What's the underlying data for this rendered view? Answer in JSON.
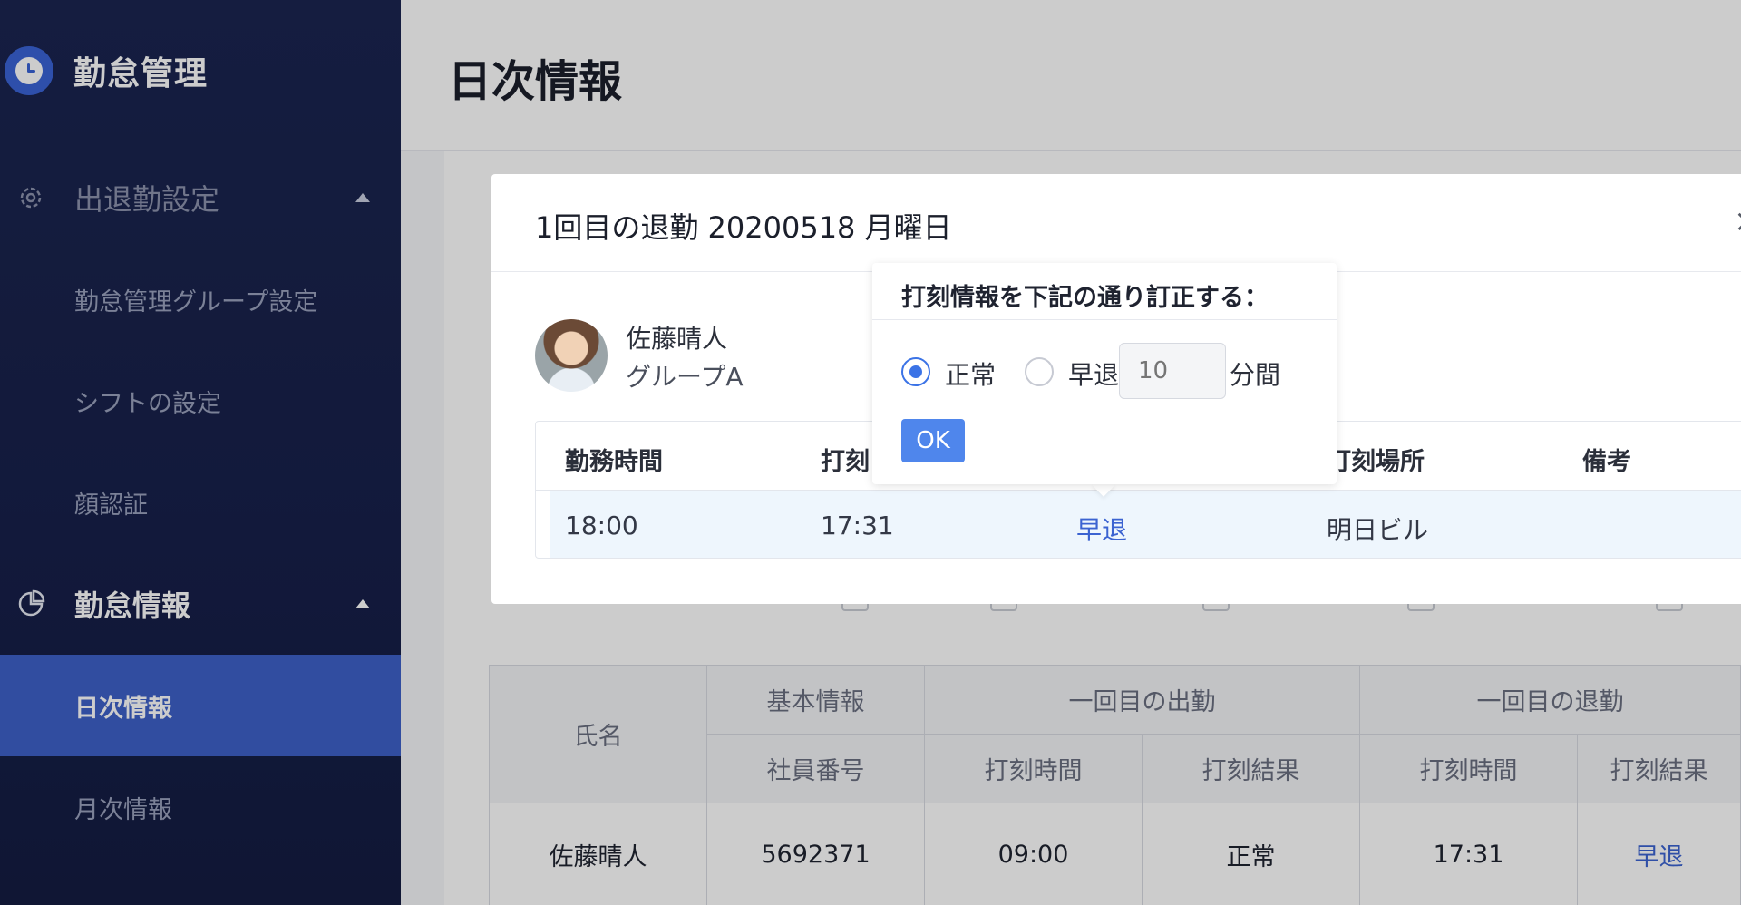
{
  "sidebar": {
    "brand": "勤怠管理",
    "groups": [
      {
        "label": "出退勤設定"
      },
      {
        "label": "勤怠情報"
      }
    ],
    "items": [
      {
        "label": "勤怠管理グループ設定"
      },
      {
        "label": "シフトの設定"
      },
      {
        "label": "顔認証"
      },
      {
        "label": "日次情報"
      },
      {
        "label": "月次情報"
      }
    ],
    "active_item": "日次情報"
  },
  "header": {
    "title": "日次情報"
  },
  "background_table": {
    "group_headers": [
      "基本情報",
      "一回目の出勤",
      "一回目の退勤"
    ],
    "headers": [
      "氏名",
      "社員番号",
      "打刻時間",
      "打刻結果",
      "打刻時間",
      "打刻結果"
    ],
    "row": [
      "佐藤晴人",
      "5692371",
      "09:00",
      "正常",
      "17:31",
      "早退"
    ]
  },
  "modal": {
    "title": "1回目の退勤  20200518 月曜日",
    "close": "×",
    "person": {
      "name": "佐藤晴人",
      "group": "グループA"
    },
    "table": {
      "headers": [
        "勤務時間",
        "打刻",
        "打刻場所",
        "備考"
      ],
      "row": {
        "work_time": "18:00",
        "punch_time": "17:31",
        "result": "早退",
        "location": "明日ビル",
        "note": ""
      }
    }
  },
  "popover": {
    "title": "打刻情報を下記の通り訂正する：",
    "option_normal": "正常",
    "option_early": "早退",
    "minutes_placeholder": "10",
    "unit": "分間",
    "ok": "OK",
    "selected": "正常"
  },
  "colors": {
    "sidebar_bg": "#1b2550",
    "active": "#3e61c9",
    "accent": "#3b73e6",
    "link": "#3b63d1"
  }
}
